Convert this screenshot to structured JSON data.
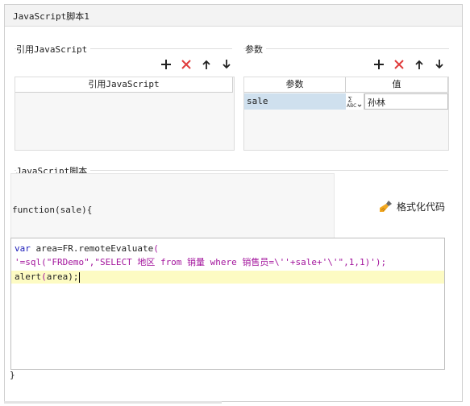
{
  "window": {
    "title": "JavaScript脚本1"
  },
  "references": {
    "section_label": "引用JavaScript",
    "column_header": "引用JavaScript",
    "rows": []
  },
  "params": {
    "section_label": "参数",
    "columns": [
      "参数",
      "值"
    ],
    "rows": [
      {
        "name": "sale",
        "value": "孙林",
        "type_icon": "formula-abc-icon"
      }
    ]
  },
  "script": {
    "section_label": "JavaScript脚本",
    "function_header": "function(sale){",
    "format_button": "格式化代码",
    "code": {
      "l1_kw": "var",
      "l1_rest": " area=FR.remoteEvaluate",
      "l1_paren": "(",
      "l2": "'=sql(\"FRDemo\",\"SELECT 地区 from 销量 where 销售员=\\''+sale+'\\'\",1,1)');",
      "l3_fn": "alert",
      "l3_open": "(",
      "l3_arg": "area",
      "l3_close": ");"
    },
    "closing": "}"
  },
  "toolbar": {
    "icons": [
      "add-icon",
      "delete-icon",
      "move-up-icon",
      "move-down-icon"
    ]
  },
  "colors": {
    "keyword": "#1a1ab8",
    "string": "#a3159d",
    "selected_row": "#cfe0ee",
    "highlight_line": "#fdfbc3",
    "delete": "#e03c3c"
  }
}
